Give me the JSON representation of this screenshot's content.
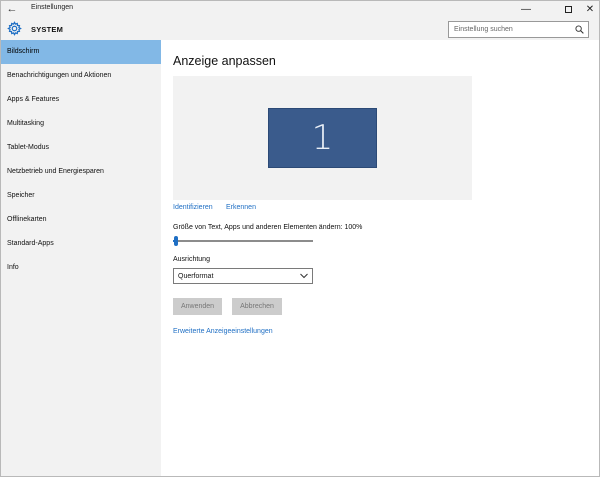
{
  "window": {
    "title": "Einstellungen",
    "back_glyph": "←",
    "minimize_glyph": "—",
    "close_glyph": "✕"
  },
  "header": {
    "section_title": "SYSTEM",
    "icon": "gear-icon",
    "search_placeholder": "Einstellung suchen",
    "search_icon": "search-icon"
  },
  "sidebar": {
    "items": [
      {
        "label": "Bildschirm",
        "active": true
      },
      {
        "label": "Benachrichtigungen und Aktionen"
      },
      {
        "label": "Apps & Features"
      },
      {
        "label": "Multitasking"
      },
      {
        "label": "Tablet-Modus"
      },
      {
        "label": "Netzbetrieb und Energiesparen"
      },
      {
        "label": "Speicher"
      },
      {
        "label": "Offlinekarten"
      },
      {
        "label": "Standard-Apps"
      },
      {
        "label": "Info"
      }
    ],
    "active_color": "#82b8e6"
  },
  "main": {
    "title": "Anzeige anpassen",
    "monitor_number": "1",
    "monitor_color": "#3a5b8c",
    "identify_link": "Identifizieren",
    "detect_link": "Erkennen",
    "scale_label": "Größe von Text, Apps und anderen Elementen ändern: 100%",
    "scale_value_percent": 0,
    "orientation_label": "Ausrichtung",
    "orientation_value": "Querformat",
    "apply_button": "Anwenden",
    "cancel_button": "Abbrechen",
    "advanced_link": "Erweiterte Anzeigeeinstellungen",
    "link_color": "#1f6fc4"
  }
}
